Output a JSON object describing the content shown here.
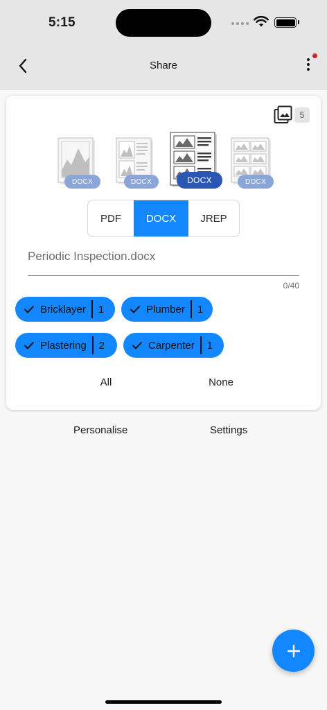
{
  "status_bar": {
    "time": "5:15"
  },
  "app_bar": {
    "title": "Share"
  },
  "card": {
    "image_count": "5",
    "layouts": [
      {
        "label": "DOCX",
        "selected": false
      },
      {
        "label": "DOCX",
        "selected": false
      },
      {
        "label": "DOCX",
        "selected": true
      },
      {
        "label": "DOCX",
        "selected": false
      }
    ],
    "formats": {
      "pdf": "PDF",
      "docx": "DOCX",
      "jrep": "JREP",
      "selected": "DOCX"
    },
    "filename": {
      "value": "Periodic Inspection.docx",
      "counter": "0/40"
    },
    "chips": [
      {
        "label": "Bricklayer",
        "count": "1"
      },
      {
        "label": "Plumber",
        "count": "1"
      },
      {
        "label": "Plastering",
        "count": "2"
      },
      {
        "label": "Carpenter",
        "count": "1"
      }
    ],
    "select_all": "All",
    "select_none": "None"
  },
  "links": {
    "personalise": "Personalise",
    "settings": "Settings"
  },
  "colors": {
    "accent": "#1287ff",
    "pill": "#8aa6d9",
    "pill_selected": "#2b57b4",
    "notification": "#c62828"
  }
}
